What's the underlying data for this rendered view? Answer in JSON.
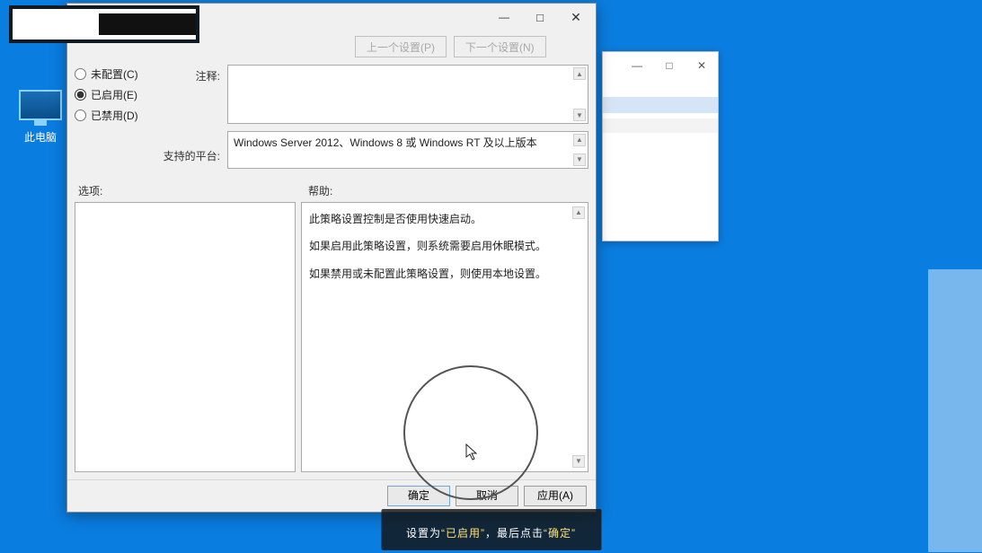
{
  "desktop": {
    "iconLabel": "此电脑"
  },
  "backWindow": {
    "minTitle": "—",
    "maxTitle": "□",
    "closeTitle": "✕"
  },
  "dialog": {
    "titlebar": {
      "min": "—",
      "max": "□",
      "close": "✕"
    },
    "nav": {
      "prev": "上一个设置(P)",
      "next": "下一个设置(N)"
    },
    "radios": {
      "notConfigured": "未配置(C)",
      "enabled": "已启用(E)",
      "disabled": "已禁用(D)",
      "selected": "enabled"
    },
    "labels": {
      "comment": "注释:",
      "supported": "支持的平台:",
      "options": "选项:",
      "help": "帮助:"
    },
    "commentValue": "",
    "supportedValue": "Windows Server 2012、Windows 8 或 Windows RT 及以上版本",
    "help": {
      "p1": "此策略设置控制是否使用快速启动。",
      "p2": "如果启用此策略设置，则系统需要启用休眠模式。",
      "p3": "如果禁用或未配置此策略设置，则使用本地设置。"
    },
    "buttons": {
      "ok": "确定",
      "cancel": "取消",
      "apply": "应用(A)"
    }
  },
  "caption": {
    "t1": "设置为",
    "q1": "“已启用”",
    "t2": "，最后点击",
    "q2": "“确定”"
  }
}
